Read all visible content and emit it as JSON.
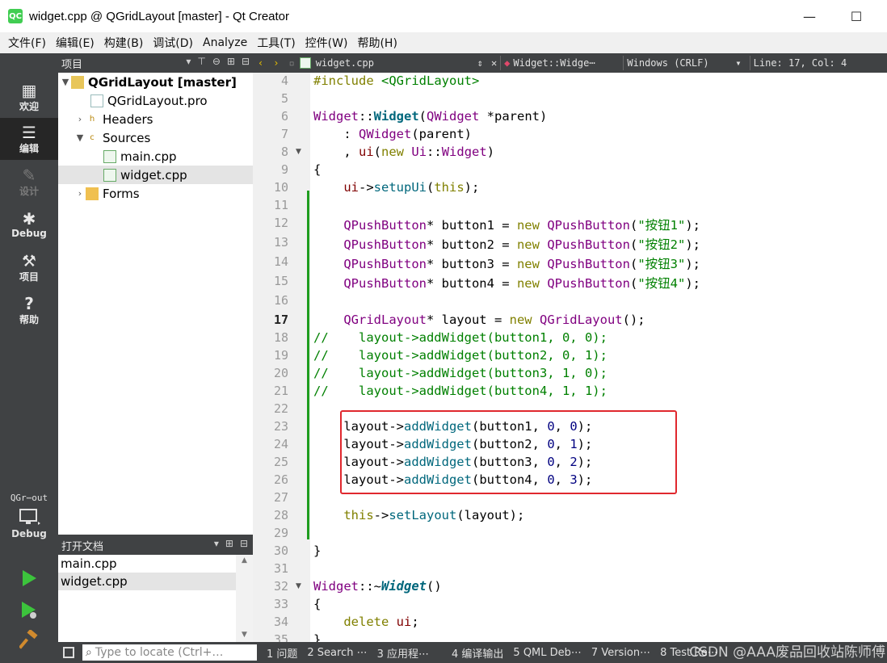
{
  "window": {
    "title": "widget.cpp @ QGridLayout [master] - Qt Creator",
    "logo_text": "QC",
    "minimize": "—",
    "maximize": "☐",
    "close": "✕"
  },
  "menubar": [
    "文件(F)",
    "编辑(E)",
    "构建(B)",
    "调试(D)",
    "Analyze",
    "工具(T)",
    "控件(W)",
    "帮助(H)"
  ],
  "modes": [
    {
      "label": "欢迎",
      "icon": "grid-icon"
    },
    {
      "label": "编辑",
      "icon": "edit-icon"
    },
    {
      "label": "设计",
      "icon": "pen-icon"
    },
    {
      "label": "Debug",
      "icon": "bug-icon"
    },
    {
      "label": "项目",
      "icon": "wrench-icon"
    },
    {
      "label": "帮助",
      "icon": "help-icon"
    }
  ],
  "target": {
    "project": "QGr⋯out",
    "kit": "Debug"
  },
  "project_panel": {
    "title": "项目",
    "tree": [
      {
        "label": "QGridLayout [master]",
        "level": 0,
        "expanded": true,
        "bold": true
      },
      {
        "label": "QGridLayout.pro",
        "level": 1
      },
      {
        "label": "Headers",
        "level": 1,
        "collapsed": true
      },
      {
        "label": "Sources",
        "level": 1,
        "expanded": true
      },
      {
        "label": "main.cpp",
        "level": 2
      },
      {
        "label": "widget.cpp",
        "level": 2,
        "selected": true
      },
      {
        "label": "Forms",
        "level": 1,
        "collapsed": true
      }
    ]
  },
  "open_docs": {
    "title": "打开文档",
    "items": [
      {
        "label": "main.cpp"
      },
      {
        "label": "widget.cpp",
        "selected": true
      }
    ]
  },
  "editor_toolbar": {
    "file": "widget.cpp",
    "symbol": "Widget::Widge⋯",
    "encoding": "Windows (CRLF)",
    "position": "Line: 17, Col: 4"
  },
  "editor": {
    "current_line": 17,
    "lines": [
      {
        "n": 4,
        "html": "<span class='kw'>#include</span> <span class='inc'>&lt;QGridLayout&gt;</span>"
      },
      {
        "n": 5,
        "html": ""
      },
      {
        "n": 6,
        "html": "<span class='ty'>Widget</span>::<span class='fnb'>Widget</span>(<span class='ty'>QWidget</span> *parent)"
      },
      {
        "n": 7,
        "html": "    : <span class='ty'>QWidget</span>(parent)"
      },
      {
        "n": 8,
        "html": "    , <span class='mem'>ui</span>(<span class='kw'>new</span> <span class='ty'>Ui</span>::<span class='ty'>Widget</span>)",
        "fold": true
      },
      {
        "n": 9,
        "html": "{"
      },
      {
        "n": 10,
        "html": "    <span class='mem'>ui</span>-&gt;<span class='fn'>setupUi</span>(<span class='kw'>this</span>);"
      },
      {
        "n": 11,
        "html": ""
      },
      {
        "n": 12,
        "html": "    <span class='ty'>QPushButton</span>* button1 = <span class='kw'>new</span> <span class='ty'>QPushButton</span>(<span class='str'>\"按钮1\"</span>);"
      },
      {
        "n": 13,
        "html": "    <span class='ty'>QPushButton</span>* button2 = <span class='kw'>new</span> <span class='ty'>QPushButton</span>(<span class='str'>\"按钮2\"</span>);"
      },
      {
        "n": 14,
        "html": "    <span class='ty'>QPushButton</span>* button3 = <span class='kw'>new</span> <span class='ty'>QPushButton</span>(<span class='str'>\"按钮3\"</span>);"
      },
      {
        "n": 15,
        "html": "    <span class='ty'>QPushButton</span>* button4 = <span class='kw'>new</span> <span class='ty'>QPushButton</span>(<span class='str'>\"按钮4\"</span>);"
      },
      {
        "n": 16,
        "html": ""
      },
      {
        "n": 17,
        "html": "    <span class='ty'>QGridLayout</span>* layout = <span class='kw'>new</span> <span class='ty'>QGridLayout</span>();"
      },
      {
        "n": 18,
        "html": "<span class='cm'>//    layout-&gt;addWidget(button1, 0, 0);</span>"
      },
      {
        "n": 19,
        "html": "<span class='cm'>//    layout-&gt;addWidget(button2, 0, 1);</span>"
      },
      {
        "n": 20,
        "html": "<span class='cm'>//    layout-&gt;addWidget(button3, 1, 0);</span>"
      },
      {
        "n": 21,
        "html": "<span class='cm'>//    layout-&gt;addWidget(button4, 1, 1);</span>"
      },
      {
        "n": 22,
        "html": ""
      },
      {
        "n": 23,
        "html": "    layout-&gt;<span class='fn'>addWidget</span>(button1, <span class='num'>0</span>, <span class='num'>0</span>);"
      },
      {
        "n": 24,
        "html": "    layout-&gt;<span class='fn'>addWidget</span>(button2, <span class='num'>0</span>, <span class='num'>1</span>);"
      },
      {
        "n": 25,
        "html": "    layout-&gt;<span class='fn'>addWidget</span>(button3, <span class='num'>0</span>, <span class='num'>2</span>);"
      },
      {
        "n": 26,
        "html": "    layout-&gt;<span class='fn'>addWidget</span>(button4, <span class='num'>0</span>, <span class='num'>3</span>);"
      },
      {
        "n": 27,
        "html": ""
      },
      {
        "n": 28,
        "html": "    <span class='kw'>this</span>-&gt;<span class='fn'>setLayout</span>(layout);"
      },
      {
        "n": 29,
        "html": ""
      },
      {
        "n": 30,
        "html": "}"
      },
      {
        "n": 31,
        "html": ""
      },
      {
        "n": 32,
        "html": "<span class='ty'>Widget</span>::~<span class='fni'>Widget</span>()",
        "fold": true
      },
      {
        "n": 33,
        "html": "{"
      },
      {
        "n": 34,
        "html": "    <span class='kw'>delete</span> <span class='mem'>ui</span>;"
      },
      {
        "n": 35,
        "html": "}"
      }
    ]
  },
  "statusbar": {
    "locator_placeholder": "Type to locate (Ctrl+…",
    "tabs": [
      "1 问题",
      "2 Search ⋯",
      "3 应用程⋯",
      "4 编译输出",
      "5 QML Deb⋯",
      "7 Version⋯",
      "8 Test Re⋯"
    ]
  },
  "watermark": "CSDN @AAA废品回收站陈师傅",
  "colors": {
    "accent": "#41cd52",
    "highlight_box": "#e0282e",
    "change_bar": "#1f9d1f"
  }
}
